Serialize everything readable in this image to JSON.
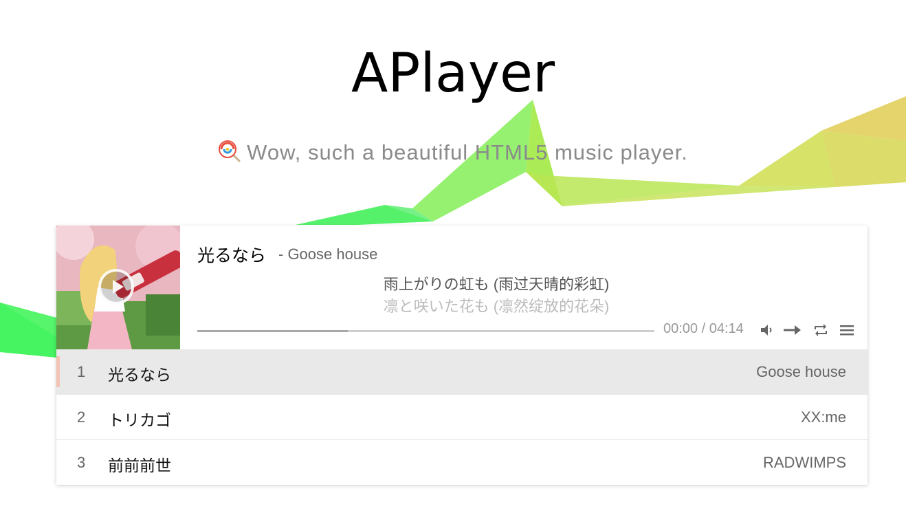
{
  "page": {
    "title": "APlayer",
    "subtitle": "Wow, such a beautiful HTML5 music player.",
    "subtitle_icon": "lollipop-icon"
  },
  "player": {
    "now_playing": {
      "title": "光るなら",
      "author": "- Goose house",
      "cover_icon": "album-cover-image"
    },
    "lyrics": {
      "current": "雨上がりの虹も (雨过天晴的彩虹)",
      "next": "凛と咲いた花も (凛然绽放的花朵)"
    },
    "progress": {
      "loaded_fraction": 0.33,
      "played_fraction": 0.0
    },
    "time": "00:00 / 04:14",
    "controls": [
      "volume-icon",
      "order-icon",
      "loop-icon",
      "menu-icon"
    ],
    "playlist": [
      {
        "index": "1",
        "title": "光るなら",
        "artist": "Goose house",
        "active": true
      },
      {
        "index": "2",
        "title": "トリカゴ",
        "artist": "XX:me",
        "active": false
      },
      {
        "index": "3",
        "title": "前前前世",
        "artist": "RADWIMPS",
        "active": false
      }
    ]
  },
  "colors": {
    "ribbon_green": "#46f25c",
    "ribbon_lime": "#9ee868",
    "ribbon_yellow": "#d4d95c",
    "active_row": "#e9e9e9",
    "active_marker": "#f1c4b5"
  }
}
